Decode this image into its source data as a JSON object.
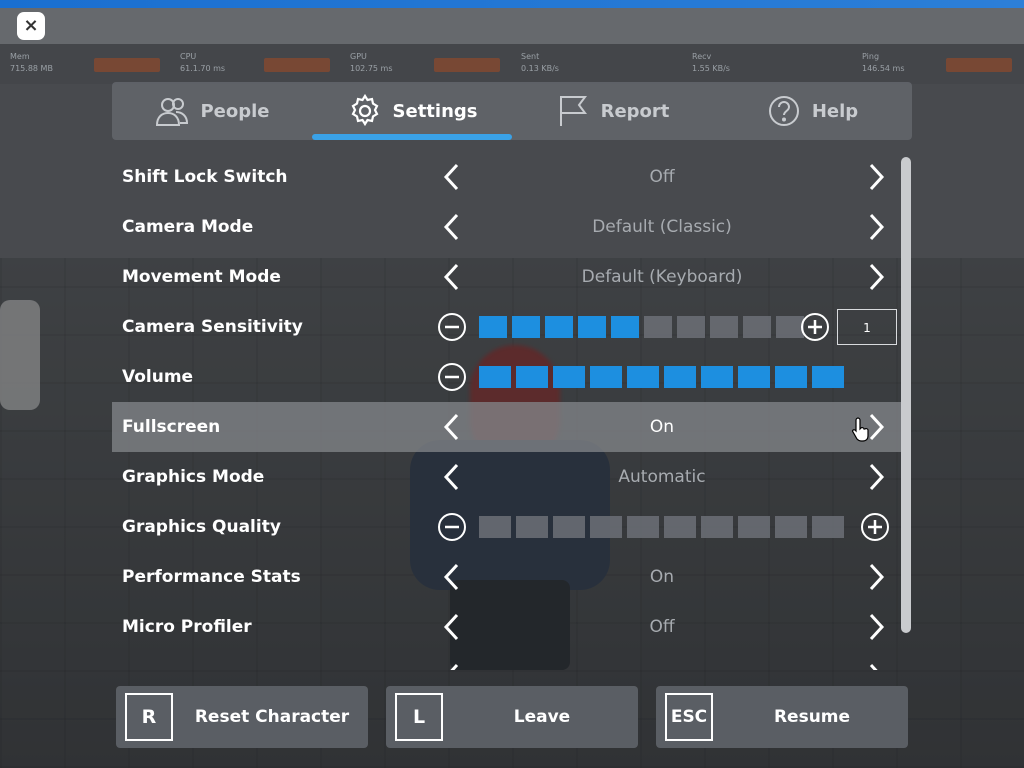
{
  "close_button": {
    "label": "×"
  },
  "stats": [
    {
      "key": "Mem",
      "value": "715.88 MB"
    },
    {
      "key": "CPU",
      "value": "61.1.70 ms"
    },
    {
      "key": "GPU",
      "value": "102.75 ms"
    },
    {
      "key": "Sent",
      "value": "0.13 KB/s"
    },
    {
      "key": "Recv",
      "value": "1.55 KB/s"
    },
    {
      "key": "Ping",
      "value": "146.54 ms"
    }
  ],
  "tabs": [
    {
      "label": "People",
      "icon": "people-icon"
    },
    {
      "label": "Settings",
      "icon": "gear-icon",
      "active": true
    },
    {
      "label": "Report",
      "icon": "flag-icon"
    },
    {
      "label": "Help",
      "icon": "question-icon"
    }
  ],
  "settings": [
    {
      "label": "Shift Lock Switch",
      "type": "selector",
      "value": "Off"
    },
    {
      "label": "Camera Mode",
      "type": "selector",
      "value": "Default (Classic)"
    },
    {
      "label": "Movement Mode",
      "type": "selector",
      "value": "Default (Keyboard)"
    },
    {
      "label": "Camera Sensitivity",
      "type": "slider",
      "level": 5,
      "max": 10,
      "input_value": "1"
    },
    {
      "label": "Volume",
      "type": "slider",
      "level": 10,
      "max": 10
    },
    {
      "label": "Fullscreen",
      "type": "selector",
      "value": "On",
      "highlighted": true
    },
    {
      "label": "Graphics Mode",
      "type": "selector",
      "value": "Automatic"
    },
    {
      "label": "Graphics Quality",
      "type": "slider",
      "level": 0,
      "max": 10
    },
    {
      "label": "Performance Stats",
      "type": "selector",
      "value": "On"
    },
    {
      "label": "Micro Profiler",
      "type": "selector",
      "value": "Off"
    }
  ],
  "bottom_buttons": [
    {
      "key": "R",
      "label": "Reset Character"
    },
    {
      "key": "L",
      "label": "Leave"
    },
    {
      "key": "ESC",
      "label": "Resume"
    }
  ],
  "colors": {
    "accent": "#3aa2e8",
    "slider_on": "#1d8fe0",
    "slider_off": "#6c7077"
  }
}
